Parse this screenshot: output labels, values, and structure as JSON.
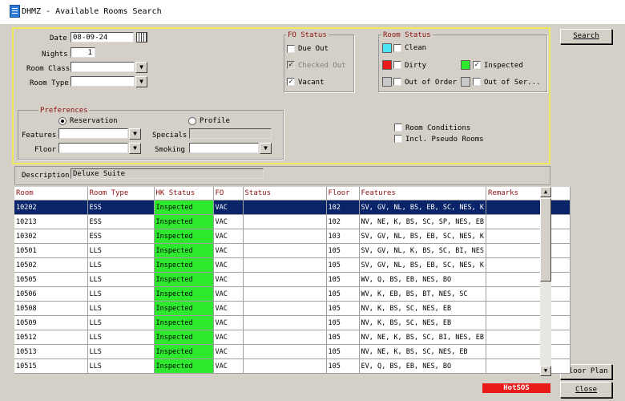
{
  "window": {
    "title": "DHMZ - Available Rooms Search"
  },
  "search": {
    "date_label": "Date",
    "date_value": "08-09-24",
    "nights_label": "Nights",
    "nights_value": "1",
    "room_class_label": "Room Class",
    "room_class_value": "",
    "room_type_label": "Room Type",
    "room_type_value": ""
  },
  "fo_status": {
    "title": "FO Status",
    "due_out": {
      "label": "Due Out",
      "checked": false
    },
    "checked_out": {
      "label": "Checked Out",
      "checked": true,
      "disabled": true
    },
    "vacant": {
      "label": "Vacant",
      "checked": true
    }
  },
  "room_status": {
    "title": "Room Status",
    "clean": {
      "label": "Clean",
      "checked": false,
      "color": "#4de4f4"
    },
    "dirty": {
      "label": "Dirty",
      "checked": false,
      "color": "#e81a1a"
    },
    "inspected": {
      "label": "Inspected",
      "checked": true,
      "color": "#2ee82e"
    },
    "out_of_order": {
      "label": "Out of Order",
      "checked": false,
      "color": "#c8c8c8"
    },
    "out_of_service": {
      "label": "Out of Ser...",
      "checked": false,
      "color": "#c8c8c8"
    }
  },
  "preferences": {
    "title": "Preferences",
    "reservation_label": "Reservation",
    "profile_label": "Profile",
    "features_label": "Features",
    "features_value": "",
    "floor_label": "Floor",
    "floor_value": "",
    "specials_label": "Specials",
    "specials_value": "",
    "smoking_label": "Smoking",
    "smoking_value": ""
  },
  "options": {
    "room_conditions": {
      "label": "Room Conditions",
      "checked": false
    },
    "pseudo_rooms": {
      "label": "Incl. Pseudo Rooms",
      "checked": false
    }
  },
  "description": {
    "label": "Description",
    "value": "Deluxe Suite"
  },
  "buttons": {
    "search": "Search",
    "floor_plan": "Floor Plan",
    "close": "Close",
    "hotsos": "HotSOS"
  },
  "table": {
    "columns": [
      "Room",
      "Room Type",
      "HK Status",
      "FO",
      "Status",
      "Floor",
      "Features",
      "Remarks"
    ],
    "rows": [
      {
        "room": "10202",
        "room_type": "ESS",
        "hk": "Inspected",
        "fo": "VAC",
        "status": "",
        "floor": "102",
        "features": "SV, GV, NL, BS, EB, SC, NES, K",
        "remarks": ""
      },
      {
        "room": "10213",
        "room_type": "ESS",
        "hk": "Inspected",
        "fo": "VAC",
        "status": "",
        "floor": "102",
        "features": "NV, NE, K, BS, SC, SP, NES, EB",
        "remarks": ""
      },
      {
        "room": "10302",
        "room_type": "ESS",
        "hk": "Inspected",
        "fo": "VAC",
        "status": "",
        "floor": "103",
        "features": "SV, GV, NL, BS, EB, SC, NES, K",
        "remarks": ""
      },
      {
        "room": "10501",
        "room_type": "LLS",
        "hk": "Inspected",
        "fo": "VAC",
        "status": "",
        "floor": "105",
        "features": "SV, GV, NL, K, BS, SC, BI, NES",
        "remarks": ""
      },
      {
        "room": "10502",
        "room_type": "LLS",
        "hk": "Inspected",
        "fo": "VAC",
        "status": "",
        "floor": "105",
        "features": "SV, GV, NL, BS, EB, SC, NES, K",
        "remarks": ""
      },
      {
        "room": "10505",
        "room_type": "LLS",
        "hk": "Inspected",
        "fo": "VAC",
        "status": "",
        "floor": "105",
        "features": "WV, Q, BS, EB, NES, BO",
        "remarks": ""
      },
      {
        "room": "10506",
        "room_type": "LLS",
        "hk": "Inspected",
        "fo": "VAC",
        "status": "",
        "floor": "105",
        "features": "WV, K, EB, BS, BT, NES, SC",
        "remarks": ""
      },
      {
        "room": "10508",
        "room_type": "LLS",
        "hk": "Inspected",
        "fo": "VAC",
        "status": "",
        "floor": "105",
        "features": "NV, K, BS, SC, NES, EB",
        "remarks": ""
      },
      {
        "room": "10509",
        "room_type": "LLS",
        "hk": "Inspected",
        "fo": "VAC",
        "status": "",
        "floor": "105",
        "features": "NV, K, BS, SC, NES, EB",
        "remarks": ""
      },
      {
        "room": "10512",
        "room_type": "LLS",
        "hk": "Inspected",
        "fo": "VAC",
        "status": "",
        "floor": "105",
        "features": "NV, NE, K, BS, SC, BI, NES, EB",
        "remarks": ""
      },
      {
        "room": "10513",
        "room_type": "LLS",
        "hk": "Inspected",
        "fo": "VAC",
        "status": "",
        "floor": "105",
        "features": "NV, NE, K, BS, SC, NES, EB",
        "remarks": ""
      },
      {
        "room": "10515",
        "room_type": "LLS",
        "hk": "Inspected",
        "fo": "VAC",
        "status": "",
        "floor": "105",
        "features": "EV, Q, BS, EB, NES, BO",
        "remarks": ""
      }
    ]
  }
}
